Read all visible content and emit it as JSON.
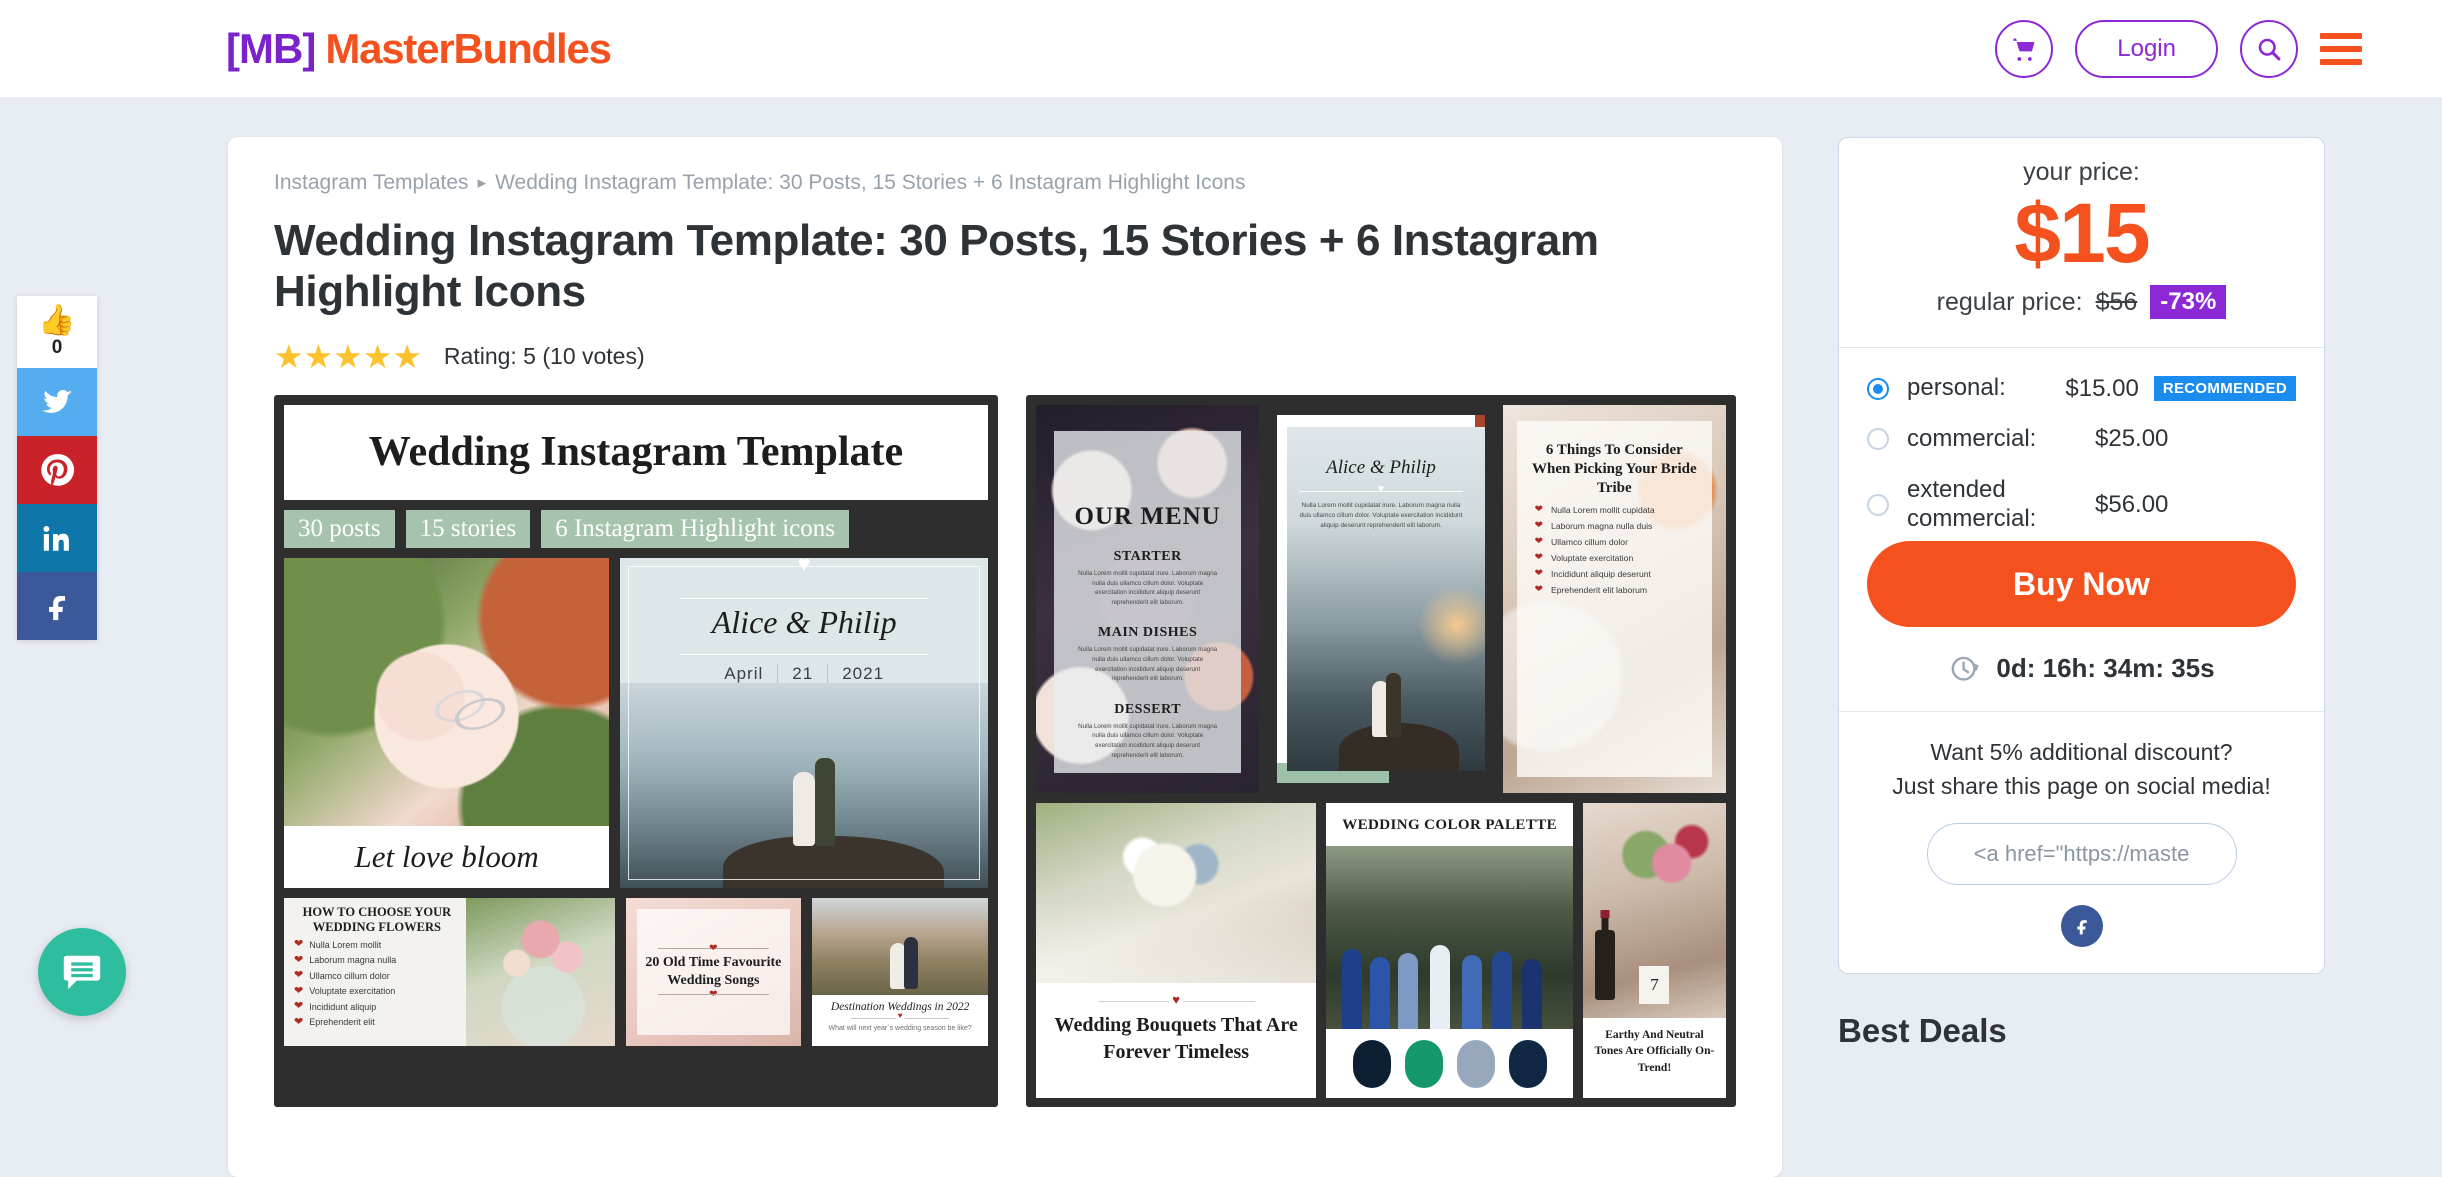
{
  "header": {
    "logo_bracket_left": "[",
    "logo_mb": "MB",
    "logo_bracket_right": "]",
    "logo_text": "MasterBundles",
    "cart_icon": "shopping-cart-icon",
    "login_label": "Login",
    "search_icon": "search-icon",
    "menu_icon": "hamburger-menu-icon"
  },
  "social_rail": {
    "like_icon": "thumbs-up-icon",
    "like_count": "0",
    "items": [
      {
        "name": "twitter",
        "icon": "twitter-icon",
        "color": "#55acee"
      },
      {
        "name": "pinterest",
        "icon": "pinterest-icon",
        "color": "#c92228"
      },
      {
        "name": "linkedin",
        "icon": "linkedin-icon",
        "color": "#0e76a8"
      },
      {
        "name": "facebook",
        "icon": "facebook-icon",
        "color": "#3b5998"
      }
    ]
  },
  "chat": {
    "icon": "chat-message-icon",
    "color": "#2ebd9f"
  },
  "breadcrumb": {
    "parent": "Instagram Templates",
    "separator": "▸",
    "current": "Wedding Instagram Template: 30 Posts, 15 Stories + 6 Instagram Highlight Icons"
  },
  "product": {
    "title": "Wedding Instagram Template: 30 Posts, 15 Stories + 6 Instagram Highlight Icons",
    "rating_stars": "★★★★★",
    "rating_text": "Rating: 5 (10 votes)"
  },
  "gallery": {
    "shot_a": {
      "banner_title": "Wedding Instagram Template",
      "tags": [
        "30 posts",
        "15 stories",
        "6 Instagram Highlight icons"
      ],
      "flower_caption": "Let love bloom",
      "couple": {
        "names": "Alice & Philip",
        "month": "April",
        "day": "21",
        "year": "2021"
      },
      "how_to": {
        "title": "HOW TO CHOOSE YOUR WEDDING FLOWERS",
        "items": [
          "Nulla Lorem mollit",
          "Laborum magna nulla",
          "Ullamco cillum dolor",
          "Voluptate exercitation",
          "Incididunt aliquip",
          "Eprehenderit elit"
        ]
      },
      "songs_title": "20 Old Time Favourite Wedding Songs",
      "destination": {
        "title": "Destination Weddings in 2022",
        "subtitle": "What will next year´s wedding season be like?"
      }
    },
    "shot_b": {
      "menu": {
        "heading": "OUR MENU",
        "sections": [
          {
            "name": "STARTER",
            "body": "Nulla Lorem mollit cupidatat irure. Laborum magna nulla duis ullamco cillum dolor. Voluptate exercitation incididunt aliquip deserunt reprehenderit elit laborum."
          },
          {
            "name": "MAIN DISHES",
            "body": "Nulla Lorem mollit cupidatat irure. Laborum magna nulla duis ullamco cillum dolor. Voluptate exercitation incididunt aliquip deserunt reprehenderit elit laborum."
          },
          {
            "name": "DESSERT",
            "body": "Nulla Lorem mollit cupidatat irure. Laborum magna nulla duis ullamco cillum dolor. Voluptate exercitation incididunt aliquip deserunt reprehenderit elit laborum."
          }
        ]
      },
      "story": {
        "names": "Alice & Philip",
        "body": "Nulla Lorem mollit cupidatat irure. Laborum magna nulla duis ullamco cillum dolor. Voluptate exercitation incididunt aliquip deserunt reprehenderit elit laborum."
      },
      "things": {
        "title": "6 Things To Consider When Picking Your Bride Tribe",
        "items": [
          "Nulla Lorem mollit cupidata",
          "Laborum magna nulla duis",
          "Ullamco cillum dolor",
          "Voluptate exercitation",
          "Incididunt aliquip deserunt",
          "Eprehenderit elit laborum"
        ]
      },
      "bouquets_title": "Wedding Bouquets That Are Forever Timeless",
      "palette": {
        "heading": "WEDDING COLOR PALETTE",
        "swatches": [
          "#0d2033",
          "#14976b",
          "#97a8bd",
          "#0f2742"
        ]
      },
      "tones_caption": "Earthy And Neutral Tones Are Officially On-Trend!"
    }
  },
  "sidebar": {
    "your_price_label": "your price:",
    "price": "$15",
    "regular_price_label": "regular price:",
    "regular_price": "$56",
    "discount_badge": "-73%",
    "licenses": [
      {
        "name": "personal:",
        "price": "$15.00",
        "selected": true,
        "badge": "RECOMMENDED"
      },
      {
        "name": "commercial:",
        "price": "$25.00",
        "selected": false,
        "badge": ""
      },
      {
        "name": "extended commercial:",
        "price": "$56.00",
        "selected": false,
        "badge": ""
      }
    ],
    "buy_label": "Buy Now",
    "timer_icon": "clock-icon",
    "timer": "0d: 16h: 34m: 35s",
    "share_line1": "Want 5% additional discount?",
    "share_line2": "Just share this page on social media!",
    "share_input_value": "<a href=\"https://maste",
    "share_fb_icon": "facebook-icon",
    "best_deals_title": "Best Deals"
  },
  "colors": {
    "brand_orange": "#f4511e",
    "brand_purple": "#8c28d6",
    "accent_blue": "#1a8cf0",
    "page_bg": "#e8ecf3"
  }
}
